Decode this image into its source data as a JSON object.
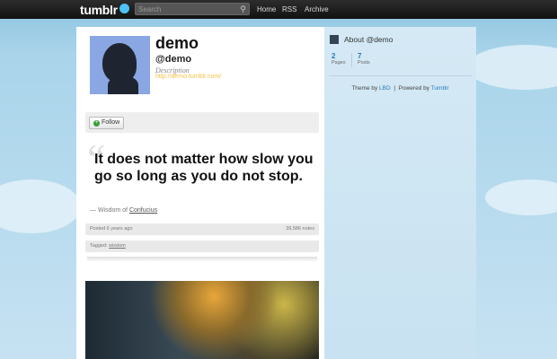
{
  "topbar": {
    "logo": "tumblr",
    "search_placeholder": "Search",
    "nav": [
      "Home",
      "RSS",
      "Archive"
    ]
  },
  "profile": {
    "name": "demo",
    "handle": "@demo",
    "description": "Description",
    "url": "http://demo.tumblr.com/",
    "follow_label": "Follow"
  },
  "post": {
    "quote": "It does not matter how slow you go so long as you do not stop.",
    "source_prefix": "— Wisdom of",
    "source_link": "Confucius",
    "posted": "Posted 6 years ago",
    "notes": "39,586 notes",
    "tagged_label": "Tagged:",
    "tag": "wisdom"
  },
  "sidebar": {
    "about": "About @demo",
    "pages_count": "2",
    "pages_label": "Pages",
    "posts_count": "7",
    "posts_label": "Posts",
    "theme_by": "Theme by",
    "theme_author": "LBD",
    "divider": "|",
    "powered_by": "Powered by",
    "powered_link": "Tumblr"
  },
  "colors": {
    "accent": "#2a7ab8",
    "url": "#f2c24a",
    "logo_dot": "#4cc3f4"
  }
}
